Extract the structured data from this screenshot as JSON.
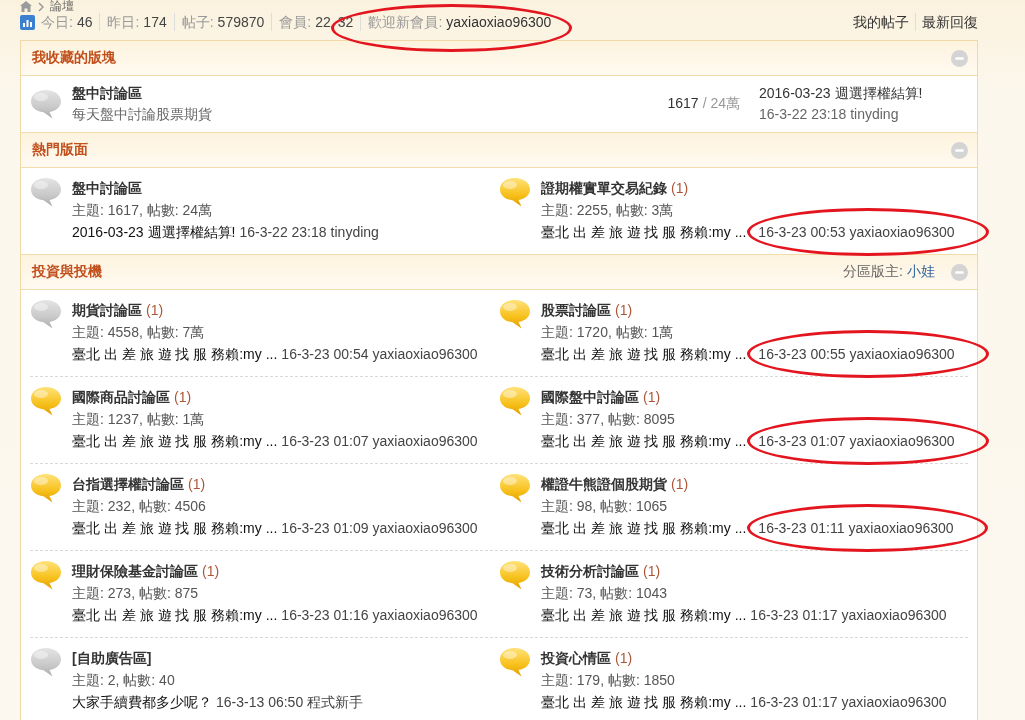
{
  "breadcrumb": [
    "論壇"
  ],
  "stats": [
    {
      "label": "今日:",
      "value": "46",
      "circled": false
    },
    {
      "label": "昨日:",
      "value": "174",
      "circled": false
    },
    {
      "label": "帖子:",
      "value": "579870",
      "circled": false
    },
    {
      "label": "會員:",
      "value": "22",
      "value_tail": "32",
      "circled": false
    },
    {
      "label": "歡迎新會員:",
      "value": "yaxiaoxiao96300",
      "kind": "link",
      "circled": true
    }
  ],
  "quick_links": [
    "我的帖子",
    "最新回復"
  ],
  "favorites": {
    "title": "我收藏的版塊",
    "forums": [
      {
        "name": "盤中討論區",
        "description": "每天盤中討論股票期貨",
        "new": false,
        "threads": "1617",
        "posts": "/ 24萬",
        "last_post": {
          "subject": "2016-03-23 週選擇權結算!",
          "time": "16-3-22 23:18",
          "user": "tinyding",
          "circled": false
        }
      }
    ]
  },
  "sections": [
    {
      "title": "熱門版面",
      "forums": [
        {
          "name": "盤中討論區",
          "new": false,
          "stats": "主題: 1617, 帖數: 24萬",
          "last_post": {
            "subject": "2016-03-23 週選擇權結算!",
            "time": "16-3-22 23:18",
            "user": "tinyding",
            "circled": false
          }
        },
        {
          "name": "證期權實單交易紀錄",
          "today": "(1)",
          "new": true,
          "stats": "主題: 2255, 帖數: 3萬",
          "last_post": {
            "subject": "臺北 出 差 旅 遊 找 服 務賴:my ...",
            "time": "16-3-23 00:53",
            "user": "yaxiaoxiao96300",
            "circled": true
          }
        }
      ]
    },
    {
      "title": "投資與投機",
      "moderator": {
        "label": "分區版主:",
        "name": "小娃"
      },
      "forums": [
        {
          "name": "期貨討論區",
          "today": "(1)",
          "new": false,
          "stats": "主題: 4558, 帖數: 7萬",
          "last_post": {
            "subject": "臺北 出 差 旅 遊 找 服 務賴:my ...",
            "time": "16-3-23 00:54",
            "user": "yaxiaoxiao96300",
            "circled": false
          }
        },
        {
          "name": "股票討論區",
          "today": "(1)",
          "new": true,
          "stats": "主題: 1720, 帖數: 1萬",
          "last_post": {
            "subject": "臺北 出 差 旅 遊 找 服 務賴:my ...",
            "time": "16-3-23 00:55",
            "user": "yaxiaoxiao96300",
            "circled": true
          }
        },
        {
          "name": "國際商品討論區",
          "today": "(1)",
          "new": true,
          "stats": "主題: 1237, 帖數: 1萬",
          "last_post": {
            "subject": "臺北 出 差 旅 遊 找 服 務賴:my ...",
            "time": "16-3-23 01:07",
            "user": "yaxiaoxiao96300",
            "circled": false
          }
        },
        {
          "name": "國際盤中討論區",
          "today": "(1)",
          "new": true,
          "stats": "主題: 377, 帖數: 8095",
          "last_post": {
            "subject": "臺北 出 差 旅 遊 找 服 務賴:my ...",
            "time": "16-3-23 01:07",
            "user": "yaxiaoxiao96300",
            "circled": true
          }
        },
        {
          "name": "台指選擇權討論區",
          "today": "(1)",
          "new": true,
          "stats": "主題: 232, 帖數: 4506",
          "last_post": {
            "subject": "臺北 出 差 旅 遊 找 服 務賴:my ...",
            "time": "16-3-23 01:09",
            "user": "yaxiaoxiao96300",
            "circled": false
          }
        },
        {
          "name": "權證牛熊證個股期貨",
          "today": "(1)",
          "new": true,
          "stats": "主題: 98, 帖數: 1065",
          "last_post": {
            "subject": "臺北 出 差 旅 遊 找 服 務賴:my ...",
            "time": "16-3-23 01:11",
            "user": "yaxiaoxiao96300",
            "circled": true
          }
        },
        {
          "name": "理財保險基金討論區",
          "today": "(1)",
          "new": true,
          "stats": "主題: 273, 帖數: 875",
          "last_post": {
            "subject": "臺北 出 差 旅 遊 找 服 務賴:my ...",
            "time": "16-3-23 01:16",
            "user": "yaxiaoxiao96300",
            "circled": false
          }
        },
        {
          "name": "技術分析討論區",
          "today": "(1)",
          "new": true,
          "stats": "主題: 73, 帖數: 1043",
          "last_post": {
            "subject": "臺北 出 差 旅 遊 找 服 務賴:my ...",
            "time": "16-3-23 01:17",
            "user": "yaxiaoxiao96300",
            "circled": false
          }
        },
        {
          "name": "[自助廣告區]",
          "new": false,
          "stats": "主題: 2, 帖數: 40",
          "last_post": {
            "subject": "大家手續費都多少呢？",
            "time": "16-3-13 06:50",
            "user": "程式新手",
            "circled": false
          }
        },
        {
          "name": "投資心情區",
          "today": "(1)",
          "new": true,
          "stats": "主題: 179, 帖數: 1850",
          "last_post": {
            "subject": "臺北 出 差 旅 遊 找 服 務賴:my ...",
            "time": "16-3-23 01:17",
            "user": "yaxiaoxiao96300",
            "circled": false
          }
        }
      ]
    }
  ]
}
